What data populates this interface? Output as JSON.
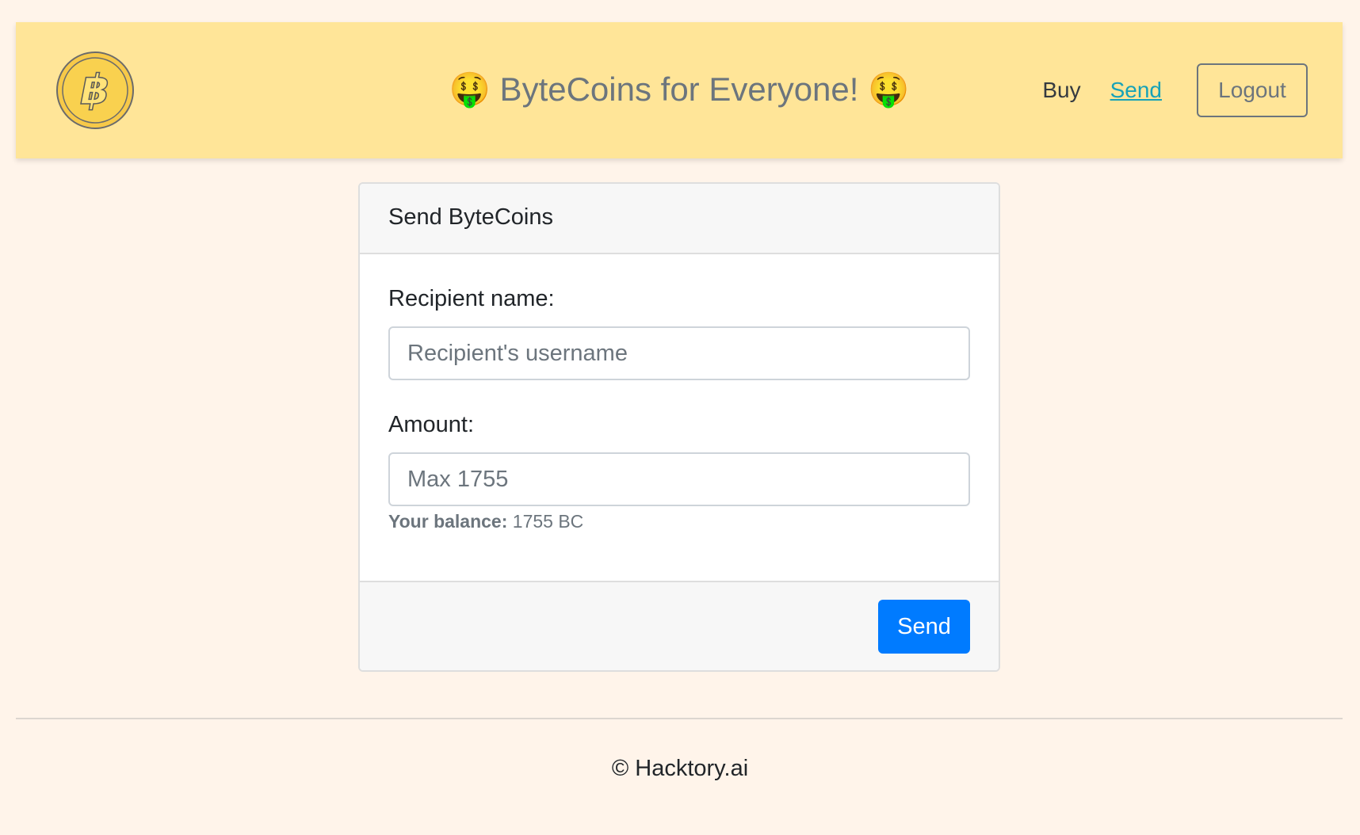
{
  "header": {
    "logo_icon": "bitcoin-logo-icon",
    "title": "🤑 ByteCoins for Everyone! 🤑",
    "brand_color": "#ffe598"
  },
  "nav": {
    "buy_label": "Buy",
    "send_label": "Send",
    "logout_label": "Logout",
    "active": "Send"
  },
  "card": {
    "title": "Send ByteCoins",
    "recipient_label": "Recipient name:",
    "recipient_placeholder": "Recipient's username",
    "recipient_value": "",
    "amount_label": "Amount:",
    "amount_placeholder": "Max 1755",
    "amount_value": "",
    "balance_label": "Your balance:",
    "balance_value": "1755 BC",
    "send_label": "Send",
    "accent_color": "#007bff"
  },
  "footer": {
    "copyright": "© Hacktory.ai"
  }
}
